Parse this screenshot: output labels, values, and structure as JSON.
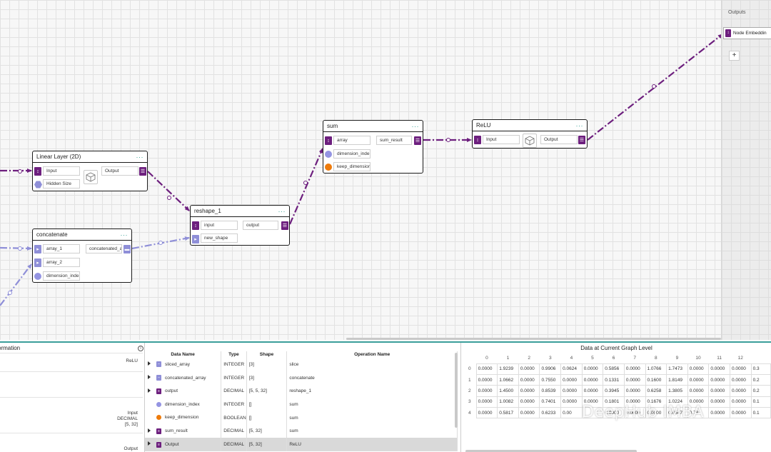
{
  "outputs_panel": {
    "title": "Outputs",
    "node_label": "Node Embeddin",
    "add_label": "+"
  },
  "nodes": {
    "linear": {
      "title": "Linear Layer (2D)",
      "in1": "Input",
      "in2": "Hidden Size",
      "out": "Output"
    },
    "concat": {
      "title": "concatenate",
      "in1": "array_1",
      "in2": "array_2",
      "in3": "dimension_inde",
      "out": "concatenated_a"
    },
    "reshape": {
      "title": "reshape_1",
      "in1": "input",
      "in2": "new_shape",
      "out": "output"
    },
    "sum": {
      "title": "sum",
      "in1": "array",
      "in2": "dimension_inde",
      "in3": "keep_dimension",
      "out": "sum_result"
    },
    "relu": {
      "title": "ReLU",
      "in1": "Input",
      "out": "Output"
    },
    "menu_glyph": "···"
  },
  "info_panel": {
    "title": "ormation",
    "icon": "i",
    "rows": [
      "ReLU",
      "Input",
      "DECIMAL",
      "[5, 32]",
      "Output"
    ]
  },
  "operations_table": {
    "headers": {
      "data_name": "Data Name",
      "type": "Type",
      "shape": "Shape",
      "operation": "Operation Name"
    },
    "rows": [
      {
        "name": "sliced_array",
        "type": "INTEGER",
        "shape": "[3]",
        "op": "slice"
      },
      {
        "name": "concatenated_array",
        "type": "INTEGER",
        "shape": "[3]",
        "op": "concatenate"
      },
      {
        "name": "output",
        "type": "DECIMAL",
        "shape": "[5, 5, 32]",
        "op": "reshape_1"
      },
      {
        "name": "dimension_index",
        "type": "INTEGER",
        "shape": "[]",
        "op": "sum"
      },
      {
        "name": "keep_dimension",
        "type": "BOOLEAN",
        "shape": "[]",
        "op": "sum"
      },
      {
        "name": "sum_result",
        "type": "DECIMAL",
        "shape": "[5, 32]",
        "op": "sum"
      },
      {
        "name": "Output",
        "type": "DECIMAL",
        "shape": "[5, 32]",
        "op": "ReLU"
      }
    ]
  },
  "data_panel": {
    "title": "Data at Current Graph Level",
    "columns": [
      "0",
      "1",
      "2",
      "3",
      "4",
      "5",
      "6",
      "7",
      "8",
      "9",
      "10",
      "11",
      "12",
      ""
    ],
    "rows": [
      {
        "index": "0",
        "values": [
          "0.0000",
          "1.9239",
          "0.0000",
          "0.9906",
          "0.0624",
          "0.0000",
          "0.5856",
          "0.0000",
          "1.0766",
          "1.7473",
          "0.0000",
          "0.0000",
          "0.0000",
          "0.3"
        ]
      },
      {
        "index": "1",
        "values": [
          "0.0000",
          "1.0662",
          "0.0000",
          "0.7550",
          "0.0000",
          "0.0000",
          "0.1331",
          "0.0000",
          "0.1600",
          "1.8149",
          "0.0000",
          "0.0000",
          "0.0000",
          "0.2"
        ]
      },
      {
        "index": "2",
        "values": [
          "0.0000",
          "1.4500",
          "0.0000",
          "0.8539",
          "0.0000",
          "0.0000",
          "0.3945",
          "0.0000",
          "0.6258",
          "1.3805",
          "0.0000",
          "0.0000",
          "0.0000",
          "0.2"
        ]
      },
      {
        "index": "3",
        "values": [
          "0.0000",
          "1.0082",
          "0.0000",
          "0.7401",
          "0.0000",
          "0.0000",
          "0.1801",
          "0.0000",
          "0.1676",
          "1.0224",
          "0.0000",
          "0.0000",
          "0.0000",
          "0.1"
        ]
      },
      {
        "index": "4",
        "values": [
          "0.0000",
          "0.5817",
          "0.0000",
          "0.6233",
          "0.00",
          "",
          "0.0000",
          "0.0000",
          "0.0000",
          "0.6547",
          "0.78",
          "0.0000",
          "0.0000",
          "0.1"
        ]
      }
    ]
  },
  "watermark": "DeepHub IMBA",
  "colors": {
    "edge": "#6d1f7e",
    "edge_light": "#8f8fd8",
    "accent": "#3a9e9a"
  }
}
